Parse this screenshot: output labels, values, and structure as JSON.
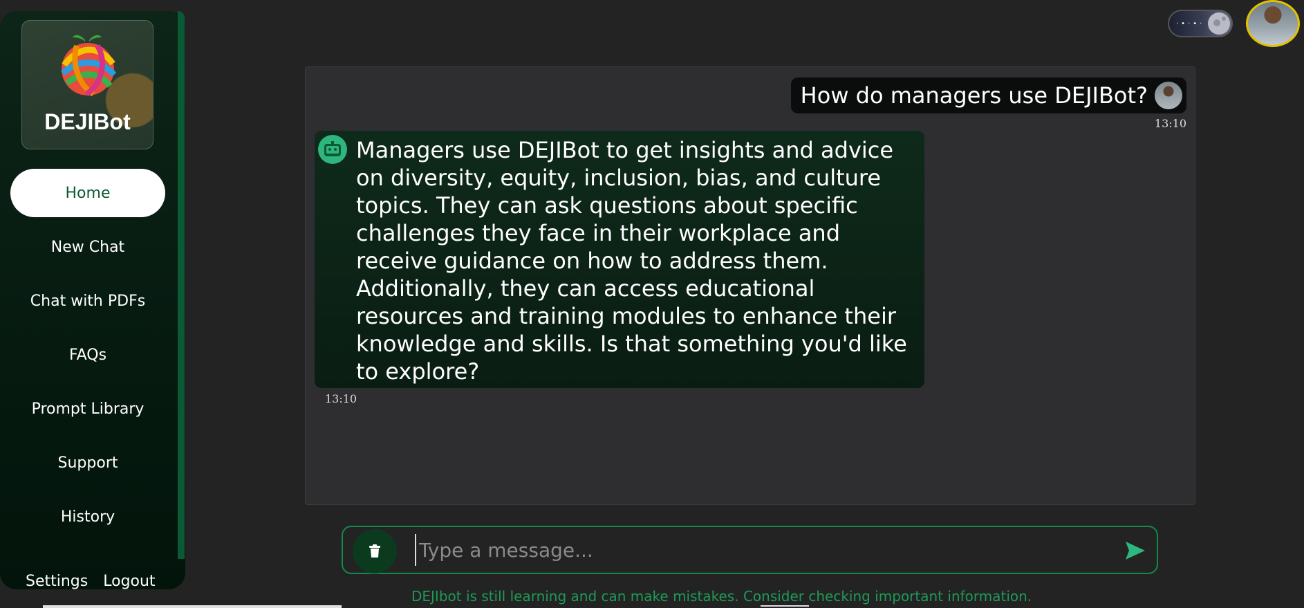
{
  "sidebar": {
    "title": "DEJIBot",
    "items": [
      {
        "label": "Home"
      },
      {
        "label": "New Chat"
      },
      {
        "label": "Chat with PDFs"
      },
      {
        "label": "FAQs"
      },
      {
        "label": "Prompt Library"
      },
      {
        "label": "Support"
      },
      {
        "label": "History"
      }
    ],
    "settings_label": "Settings",
    "logout_label": "Logout"
  },
  "chat": {
    "user_message": "How do managers use DEJIBot?",
    "user_time": "13:10",
    "bot_message": "Managers use DEJIBot to get insights and advice on diversity, equity, inclusion, bias, and culture topics. They can ask questions about specific challenges they face in their workplace and receive guidance on how to address them. Additionally, they can access educational resources and training modules to enhance their knowledge and skills. Is that something you'd like to explore?",
    "bot_time": "13:10"
  },
  "input": {
    "placeholder": "Type a message..."
  },
  "disclaimer": "DEJIbot is still learning and can make mistakes. Consider checking important information.",
  "icons": {
    "logo": "yarn-ball-logo",
    "trash": "trash-icon",
    "send": "send-icon",
    "theme": "theme-toggle",
    "bot": "robot-icon"
  },
  "colors": {
    "accent": "#138a4a",
    "sidebar_bg": "#061a10",
    "disclaimer": "#1f9a55",
    "avatar_ring": "#e3c000"
  }
}
